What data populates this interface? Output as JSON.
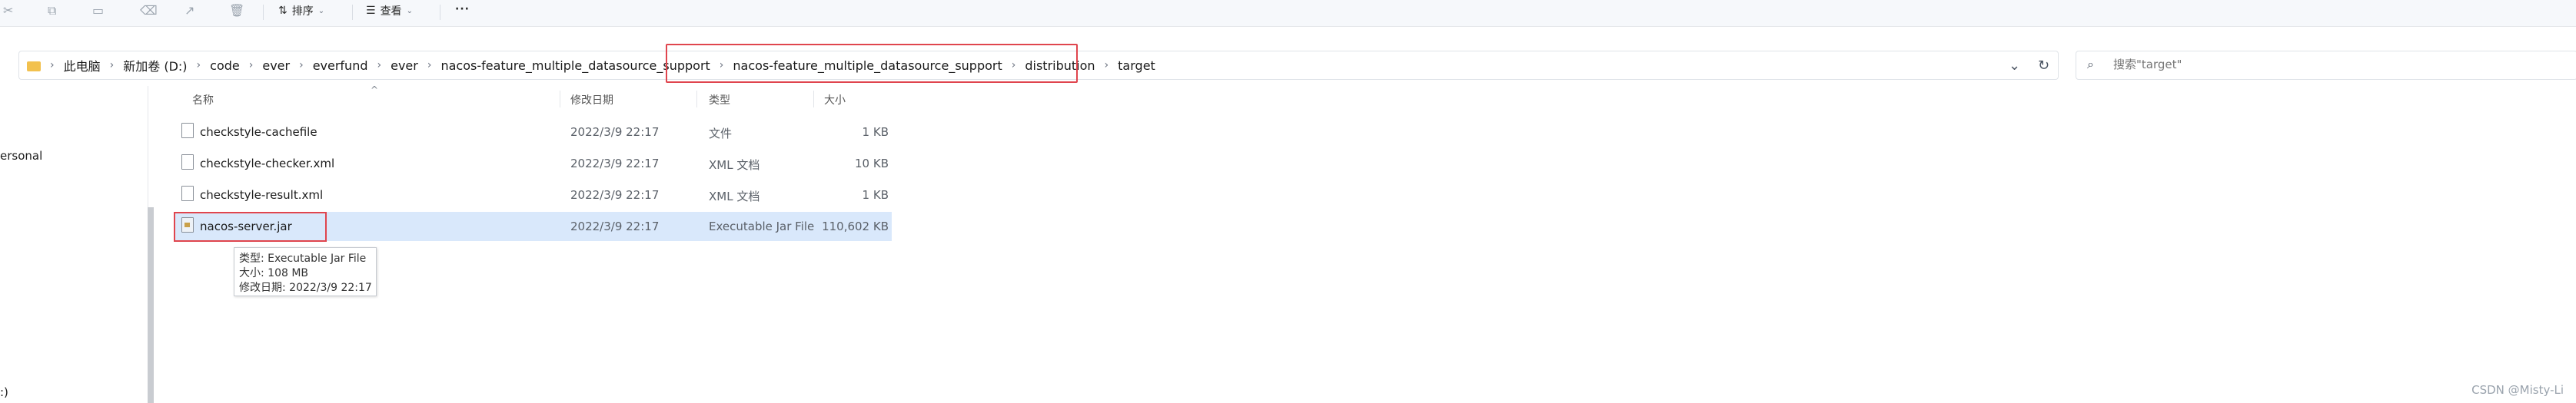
{
  "toolbar": {
    "sort_label": "排序",
    "view_label": "查看",
    "more_label": "···",
    "cut_icon": "cut-icon",
    "copy_icon": "copy-icon",
    "paste_icon": "paste-icon",
    "rename_icon": "rename-icon",
    "share_icon": "share-icon",
    "delete_icon": "delete-icon"
  },
  "address": {
    "crumbs": [
      "此电脑",
      "新加卷 (D:)",
      "code",
      "ever",
      "everfund",
      "ever",
      "nacos-feature_multiple_datasource_support",
      "nacos-feature_multiple_datasource_support",
      "distribution",
      "target"
    ],
    "dropdown_icon": "chevron-down-icon",
    "refresh_icon": "refresh-icon"
  },
  "search": {
    "placeholder": "搜索\"target\""
  },
  "nav": {
    "item_personal": "ersonal",
    "item_drive": ":)"
  },
  "columns": {
    "name": "名称",
    "date": "修改日期",
    "type": "类型",
    "size": "大小"
  },
  "files": [
    {
      "name": "checkstyle-cachefile",
      "date": "2022/3/9 22:17",
      "type": "文件",
      "size": "1 KB"
    },
    {
      "name": "checkstyle-checker.xml",
      "date": "2022/3/9 22:17",
      "type": "XML 文档",
      "size": "10 KB"
    },
    {
      "name": "checkstyle-result.xml",
      "date": "2022/3/9 22:17",
      "type": "XML 文档",
      "size": "1 KB"
    },
    {
      "name": "nacos-server.jar",
      "date": "2022/3/9 22:17",
      "type": "Executable Jar File",
      "size": "110,602 KB"
    }
  ],
  "tooltip": {
    "line1": "类型: Executable Jar File",
    "line2": "大小: 108 MB",
    "line3": "修改日期: 2022/3/9 22:17"
  },
  "watermark": "CSDN @Misty-Li",
  "colors": {
    "highlight": "#e0454e",
    "selected_row": "#d9e8fb",
    "folder": "#f2c14e"
  }
}
